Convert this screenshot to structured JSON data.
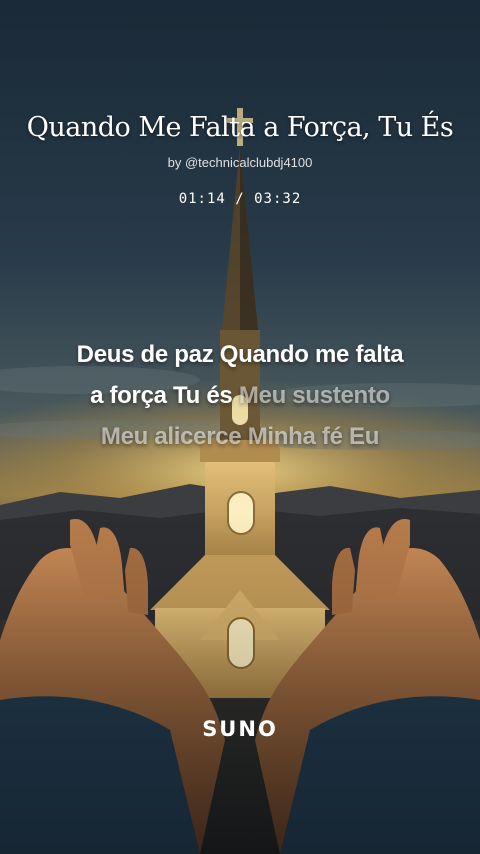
{
  "song": {
    "title": "Quando Me Falta a Força, Tu És",
    "byline": "by @technicalclubdj4100",
    "time": "01:14 / 03:32"
  },
  "lyrics": {
    "line1_sung": "Deus de paz Quando me falta",
    "line2_sung": "a força Tu és",
    "line2_unsung": "Meu sustento",
    "line3_unsung": "Meu alicerce Minha fé Eu"
  },
  "brand": {
    "logo_text": "SUNO"
  },
  "colors": {
    "sky_top": "#233544",
    "glow": "#e7c46a",
    "text": "#ffffff"
  },
  "background": {
    "icons": [
      "church-icon",
      "cross-icon",
      "praying-hands-icon",
      "mountains-icon"
    ]
  }
}
